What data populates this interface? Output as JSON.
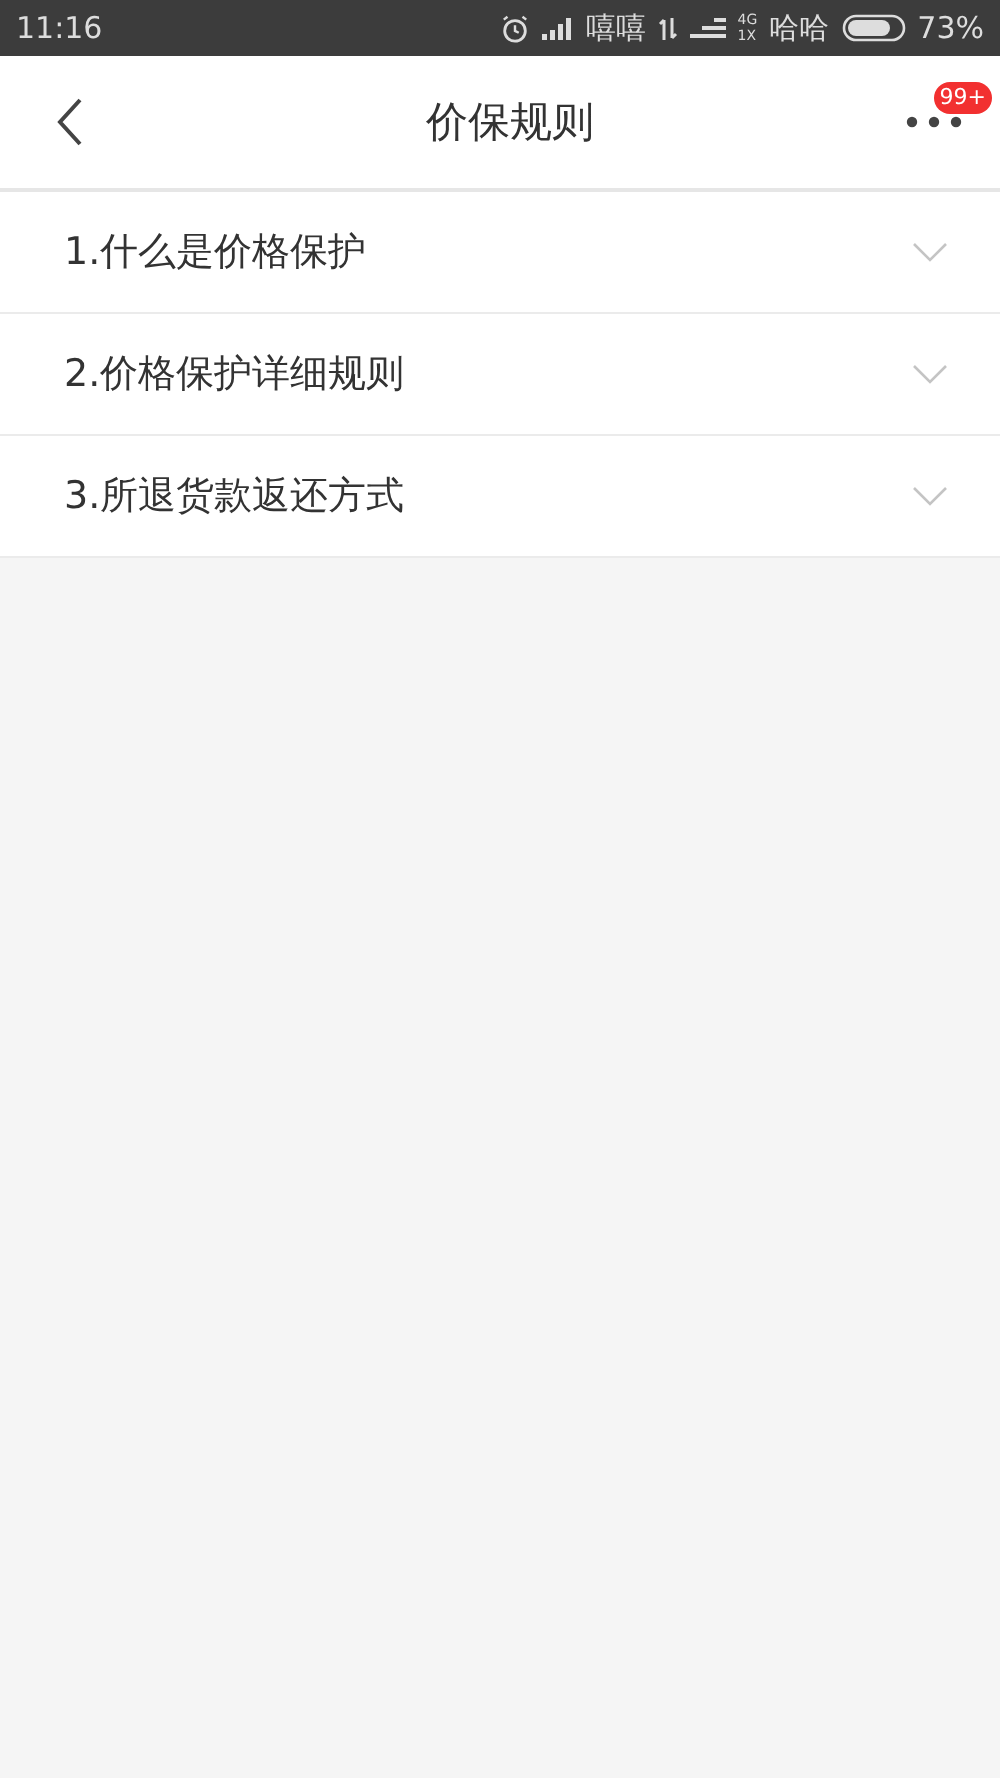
{
  "status_bar": {
    "time": "11:16",
    "carrier_1": "嘻嘻",
    "network_top": "4G",
    "network_bottom": "1X",
    "carrier_2": "哈哈",
    "battery": "73%"
  },
  "header": {
    "title": "价保规则",
    "badge": "99+"
  },
  "sections": [
    {
      "title": "1.什么是价格保护",
      "expanded": false
    },
    {
      "title": "2.价格保护详细规则",
      "expanded": false
    },
    {
      "title": "3.所退货款返还方式",
      "expanded": false
    }
  ]
}
